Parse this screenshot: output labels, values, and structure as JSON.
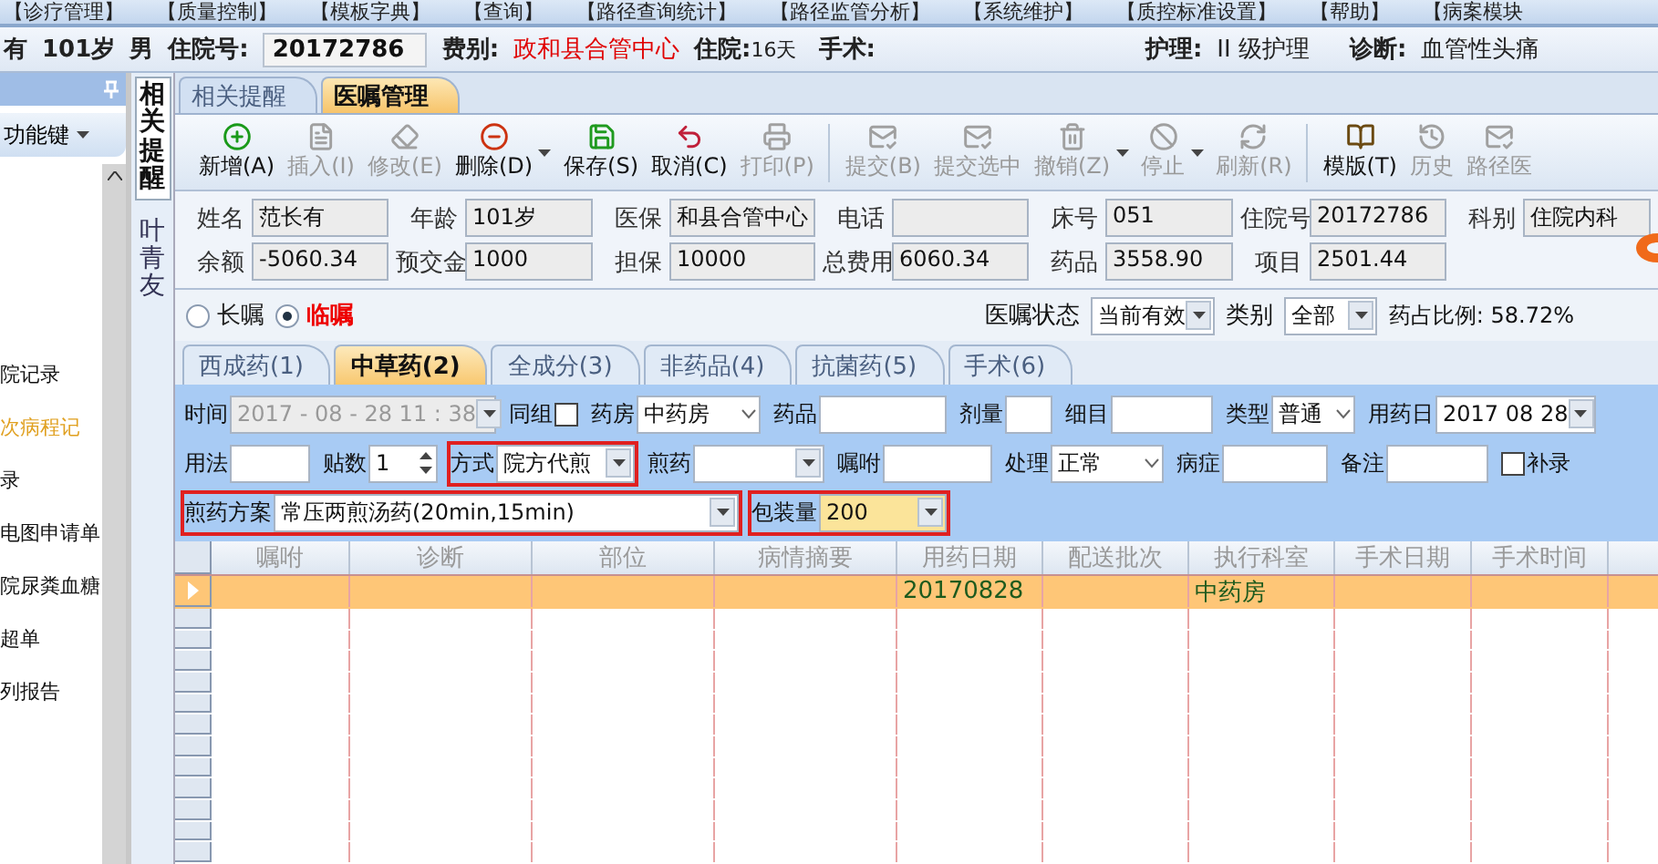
{
  "menu": [
    "【诊疗管理】",
    "【质量控制】",
    "【模板字典】",
    "【查询】",
    "【路径查询统计】",
    "【路径监管分析】",
    "【系统维护】",
    "【质控标准设置】",
    "【帮助】",
    "【病案模块"
  ],
  "patient_header": {
    "name": "有",
    "age": "101岁",
    "sex": "男",
    "admission_label": "住院号:",
    "admission_no": "20172786",
    "fee_label": "费别:",
    "fee_type": "政和县合管中心",
    "stay_label": "住院:",
    "stay": "16天",
    "surgery_label": "手术:",
    "nursing_label": "护理:",
    "nursing": "II 级护理",
    "diagnosis_label": "诊断:",
    "diagnosis": "血管性头痛"
  },
  "sidebar": {
    "function_key": "功能键",
    "items": [
      {
        "label": "院记录",
        "selected": false
      },
      {
        "label": "次病程记",
        "selected": true
      },
      {
        "label": "录",
        "selected": false
      },
      {
        "label": "电图申请单",
        "selected": false
      },
      {
        "label": "院尿粪血糖",
        "selected": false
      },
      {
        "label": "超单",
        "selected": false
      },
      {
        "label": "列报告",
        "selected": false
      }
    ]
  },
  "side_tabs": [
    {
      "label": "相关提醒",
      "selected": true
    },
    {
      "label": "叶青友",
      "selected": false
    }
  ],
  "tabs": [
    {
      "label": "相关提醒",
      "selected": false
    },
    {
      "label": "医嘱管理",
      "selected": true
    }
  ],
  "toolbar": [
    {
      "label": "新增(A)",
      "disabled": false,
      "dropdown": false
    },
    {
      "label": "插入(I)",
      "disabled": true,
      "dropdown": false
    },
    {
      "label": "修改(E)",
      "disabled": true,
      "dropdown": false
    },
    {
      "label": "删除(D)",
      "disabled": false,
      "dropdown": true
    },
    {
      "label": "保存(S)",
      "disabled": false,
      "dropdown": false
    },
    {
      "label": "取消(C)",
      "disabled": false,
      "dropdown": false
    },
    {
      "label": "打印(P)",
      "disabled": true,
      "dropdown": false
    },
    {
      "label": "提交(B)",
      "disabled": true,
      "dropdown": false
    },
    {
      "label": "提交选中",
      "disabled": true,
      "dropdown": false
    },
    {
      "label": "撤销(Z)",
      "disabled": true,
      "dropdown": true
    },
    {
      "label": "停止",
      "disabled": true,
      "dropdown": true
    },
    {
      "label": "刷新(R)",
      "disabled": true,
      "dropdown": false
    },
    {
      "label": "模版(T)",
      "disabled": false,
      "dropdown": false
    },
    {
      "label": "历史",
      "disabled": true,
      "dropdown": false
    },
    {
      "label": "路径医",
      "disabled": true,
      "dropdown": false
    }
  ],
  "info_rows": [
    [
      {
        "label": "姓名",
        "value": "范长有"
      },
      {
        "label": "年龄",
        "value": "101岁"
      },
      {
        "label": "医保",
        "value": "和县合管中心"
      },
      {
        "label": "电话"
      },
      {
        "label": "床号",
        "value": "051"
      },
      {
        "label": "住院号",
        "value": "20172786"
      },
      {
        "label": "科别",
        "value": "住院内科"
      }
    ],
    [
      {
        "label": "余额",
        "value": "-5060.34"
      },
      {
        "label": "预交金",
        "value": "1000"
      },
      {
        "label": "担保",
        "value": "10000"
      },
      {
        "label": "总费用",
        "value": "6060.34"
      },
      {
        "label": "药品",
        "value": "3558.90"
      },
      {
        "label": "项目",
        "value": "2501.44"
      }
    ]
  ],
  "order_type": [
    {
      "label": "长嘱",
      "selected": false
    },
    {
      "label": "临嘱",
      "selected": true
    }
  ],
  "status_filter": {
    "label": "医嘱状态",
    "value": "当前有效"
  },
  "category_filter": {
    "label": "类别",
    "value": "全部"
  },
  "drug_ratio": {
    "label": "药占比例:",
    "value": "58.72%"
  },
  "drug_tabs": [
    {
      "label": "西成药(1)",
      "selected": false
    },
    {
      "label": "中草药(2)",
      "selected": true
    },
    {
      "label": "全成分(3)",
      "selected": false
    },
    {
      "label": "非药品(4)",
      "selected": false
    },
    {
      "label": "抗菌药(5)",
      "selected": false
    },
    {
      "label": "手术(6)",
      "selected": false
    }
  ],
  "form_rows": [
    [
      {
        "kind": "date",
        "label": "时间",
        "value": "2017 - 08 - 28   11 : 38",
        "disabled": true,
        "highlighted": false
      },
      {
        "kind": "checkbox",
        "label": "同组",
        "checked": false,
        "highlighted": false
      },
      {
        "kind": "select",
        "label": "药房",
        "value": "中药房",
        "highlighted": false
      },
      {
        "kind": "text",
        "label": "药品",
        "highlighted": false
      },
      {
        "kind": "text",
        "label": "剂量",
        "highlighted": false
      },
      {
        "kind": "text",
        "label": "细目",
        "highlighted": false
      },
      {
        "kind": "select",
        "label": "类型",
        "value": "普通",
        "highlighted": false
      },
      {
        "kind": "date",
        "label": "用药日",
        "value": "2017 08 28",
        "disabled": false,
        "highlighted": false
      }
    ],
    [
      {
        "kind": "text",
        "label": "用法",
        "highlighted": false
      },
      {
        "kind": "spin",
        "label": "贴数",
        "value": "1",
        "highlighted": false
      },
      {
        "kind": "combo",
        "label": "方式",
        "value": "院方代煎",
        "highlighted": true
      },
      {
        "kind": "combo",
        "label": "煎药",
        "highlighted": false
      },
      {
        "kind": "text",
        "label": "嘱咐",
        "highlighted": false
      },
      {
        "kind": "select",
        "label": "处理",
        "value": "正常",
        "highlighted": false
      },
      {
        "kind": "text",
        "label": "病症",
        "highlighted": false
      },
      {
        "kind": "text",
        "label": "备注",
        "highlighted": false
      },
      {
        "kind": "checkbox_after",
        "label": "补录",
        "checked": false,
        "highlighted": false
      }
    ],
    [
      {
        "kind": "combo",
        "label": "煎药方案",
        "value": "常压两煎汤药(20min,15min)",
        "highlighted": true
      },
      {
        "kind": "combo",
        "label": "包装量",
        "value": "200",
        "focused": true,
        "highlighted": true
      }
    ]
  ],
  "grid": {
    "columns": [
      "嘱咐",
      "诊断",
      "部位",
      "病情摘要",
      "用药日期",
      "配送批次",
      "执行科室",
      "手术日期",
      "手术时间"
    ],
    "rows": [
      {
        "selected": true,
        "cells": [
          "",
          "",
          "",
          "",
          "20170828",
          "",
          "中药房",
          "",
          ""
        ]
      }
    ]
  }
}
